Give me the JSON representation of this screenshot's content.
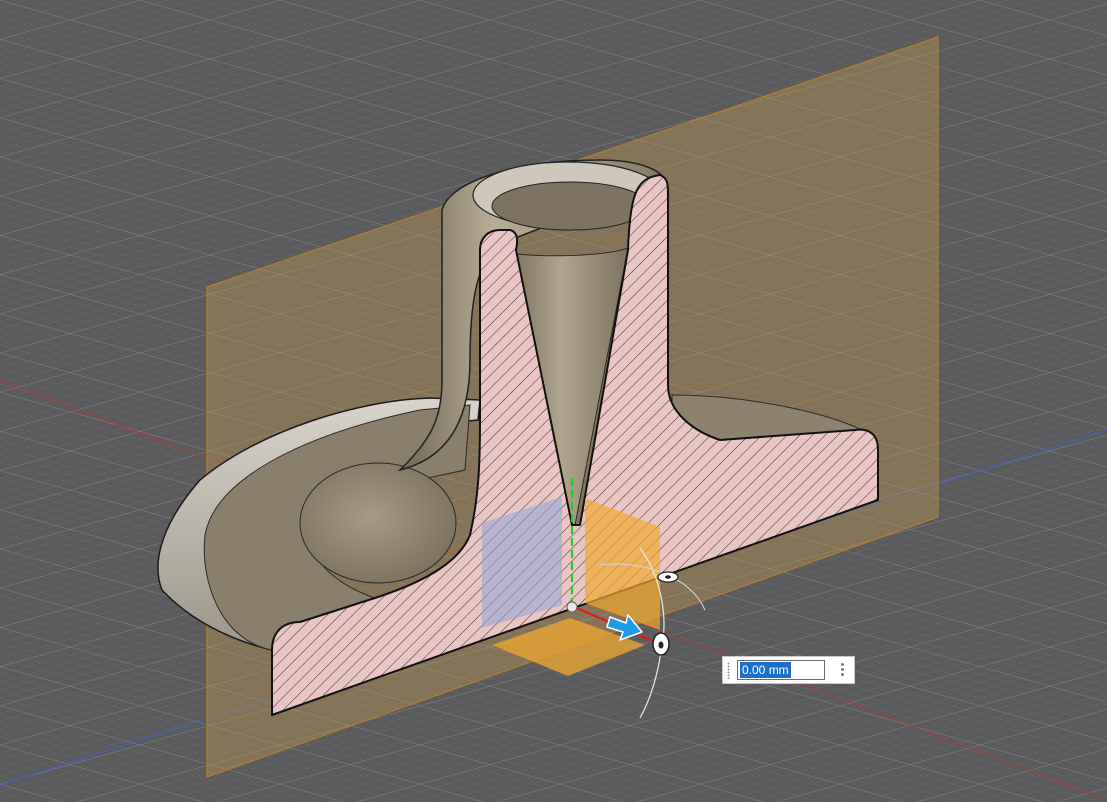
{
  "viewport": {
    "background_color": "#5b5b5d",
    "grid_color": "#8a8a8c",
    "grid_minor_color": "#6e6e70",
    "x_axis_color": "#c0392b",
    "y_axis_color": "#2e6fd8",
    "section_plane_color": "#d6a24a",
    "body_color": "#8f8470",
    "cut_face_color": "#e7c3c1",
    "hatch_color": "#3b2c2c"
  },
  "manipulator": {
    "z_axis_color": "#22cc22",
    "x_axis_color": "#e01a1a",
    "arrow_color": "#1e9be6",
    "plane_handle_color": "#f0a830",
    "yz_plane_color": "#8fa6d8",
    "arrow_icon": "move-arrow-icon",
    "rotate_handle_icon": "rotate-ring-icon"
  },
  "dimension_input": {
    "value": "0.00 mm",
    "menu_icon": "more-vertical-icon"
  }
}
